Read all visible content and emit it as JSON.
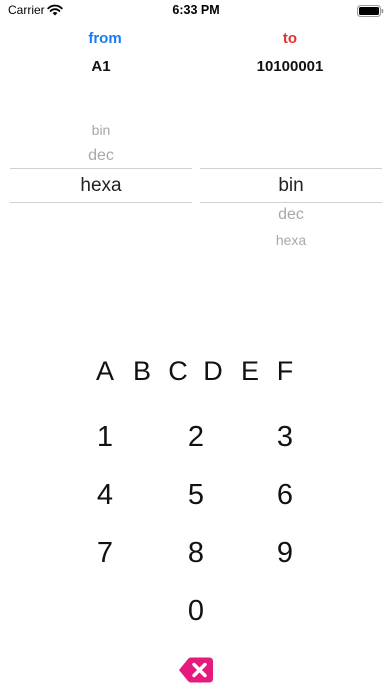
{
  "status_bar": {
    "carrier": "Carrier",
    "time": "6:33 PM",
    "wifi_icon": "wifi-icon",
    "battery_icon": "battery-icon"
  },
  "converter": {
    "from_label": "from",
    "to_label": "to",
    "from_value": "A1",
    "to_value": "10100001",
    "colors": {
      "from": "#1a7cf0",
      "to": "#e8312b",
      "delete": "#e6197d"
    }
  },
  "from_picker": {
    "options": [
      "bin",
      "dec",
      "hexa"
    ],
    "selected": "hexa"
  },
  "to_picker": {
    "options": [
      "bin",
      "dec",
      "hexa"
    ],
    "selected": "bin"
  },
  "keypad": {
    "hex_keys": [
      "A",
      "B",
      "C",
      "D",
      "E",
      "F"
    ],
    "digit_rows": [
      [
        "1",
        "2",
        "3"
      ],
      [
        "4",
        "5",
        "6"
      ],
      [
        "7",
        "8",
        "9"
      ],
      [
        "0"
      ]
    ],
    "delete_icon": "backspace-x-icon"
  }
}
